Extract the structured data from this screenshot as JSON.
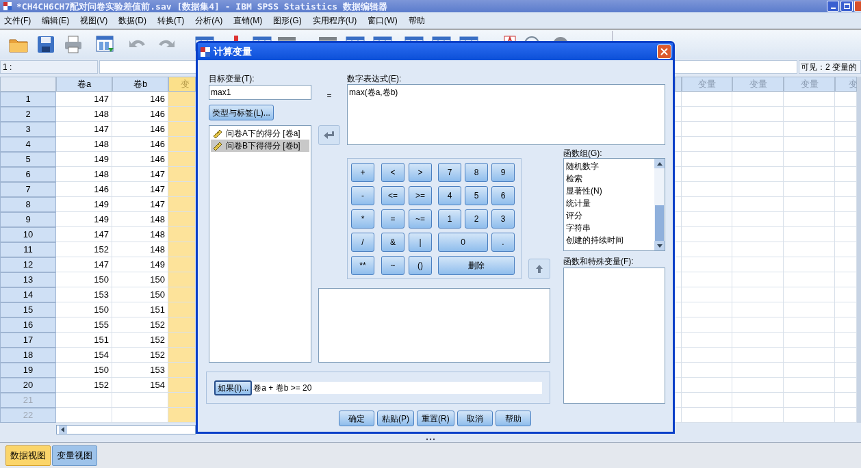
{
  "window": {
    "title": "*CH4CH6CH7配对问卷实验差值前.sav [数据集4] - IBM SPSS Statistics 数据编辑器"
  },
  "menu": [
    "文件(F)",
    "编辑(E)",
    "视图(V)",
    "数据(D)",
    "转换(T)",
    "分析(A)",
    "直销(M)",
    "图形(G)",
    "实用程序(U)",
    "窗口(W)",
    "帮助"
  ],
  "cell_editor": {
    "cell": "1 :",
    "visible": "可见：2 变量的"
  },
  "grid": {
    "columns": [
      {
        "label": "卷a",
        "highlighted": false
      },
      {
        "label": "卷b",
        "highlighted": false
      },
      {
        "label": "变",
        "highlighted": true
      }
    ],
    "right_columns": [
      "变量",
      "变量",
      "变量",
      "变"
    ],
    "rows": [
      {
        "number": "1",
        "cells": [
          "147",
          "146"
        ],
        "greyed": false
      },
      {
        "number": "2",
        "cells": [
          "148",
          "146"
        ],
        "greyed": false
      },
      {
        "number": "3",
        "cells": [
          "147",
          "146"
        ],
        "greyed": false
      },
      {
        "number": "4",
        "cells": [
          "148",
          "146"
        ],
        "greyed": false
      },
      {
        "number": "5",
        "cells": [
          "149",
          "146"
        ],
        "greyed": false
      },
      {
        "number": "6",
        "cells": [
          "148",
          "147"
        ],
        "greyed": false
      },
      {
        "number": "7",
        "cells": [
          "146",
          "147"
        ],
        "greyed": false
      },
      {
        "number": "8",
        "cells": [
          "149",
          "147"
        ],
        "greyed": false
      },
      {
        "number": "9",
        "cells": [
          "149",
          "148"
        ],
        "greyed": false
      },
      {
        "number": "10",
        "cells": [
          "147",
          "148"
        ],
        "greyed": false
      },
      {
        "number": "11",
        "cells": [
          "152",
          "148"
        ],
        "greyed": false
      },
      {
        "number": "12",
        "cells": [
          "147",
          "149"
        ],
        "greyed": false
      },
      {
        "number": "13",
        "cells": [
          "150",
          "150"
        ],
        "greyed": false
      },
      {
        "number": "14",
        "cells": [
          "153",
          "150"
        ],
        "greyed": false
      },
      {
        "number": "15",
        "cells": [
          "150",
          "151"
        ],
        "greyed": false
      },
      {
        "number": "16",
        "cells": [
          "155",
          "152"
        ],
        "greyed": false
      },
      {
        "number": "17",
        "cells": [
          "151",
          "152"
        ],
        "greyed": false
      },
      {
        "number": "18",
        "cells": [
          "154",
          "152"
        ],
        "greyed": false
      },
      {
        "number": "19",
        "cells": [
          "150",
          "153"
        ],
        "greyed": false
      },
      {
        "number": "20",
        "cells": [
          "152",
          "154"
        ],
        "greyed": false
      },
      {
        "number": "21",
        "greyed": true
      },
      {
        "number": "22",
        "greyed": true
      }
    ]
  },
  "view_tabs": [
    {
      "label": "数据视图",
      "selected": true
    },
    {
      "label": "变量视图",
      "selected": false
    }
  ],
  "dialog": {
    "title": "计算变量",
    "target_label": "目标变量(T):",
    "target_value": "max1",
    "equals": "=",
    "type_button": "类型与标签(L)...",
    "variables": [
      {
        "label": "问卷A下的得分 [卷a]",
        "selected": false
      },
      {
        "label": "问卷B下得得分 [卷b]",
        "selected": true
      }
    ],
    "expression_label": "数字表达式(E):",
    "expression": "max(卷a,卷b)",
    "keypad": [
      [
        "+",
        "<",
        ">",
        "7",
        "8",
        "9"
      ],
      [
        "-",
        "<=",
        ">=",
        "4",
        "5",
        "6"
      ],
      [
        "*",
        "=",
        "~=",
        "1",
        "2",
        "3"
      ],
      [
        "/",
        "&",
        "|",
        "0",
        "."
      ],
      [
        "**",
        "~",
        "()",
        "删除"
      ]
    ],
    "function_group_label": "函数组(G):",
    "function_groups": [
      "随机数字",
      "检索",
      "显著性(N)",
      "统计量",
      "评分",
      "字符串",
      "创建的持续时间"
    ],
    "functions_label": "函数和特殊变量(F):",
    "if_button": "如果(I)...",
    "if_condition": "卷a + 卷b >= 20",
    "buttons": [
      "确定",
      "粘贴(P)",
      "重置(R)",
      "取消",
      "帮助"
    ]
  }
}
